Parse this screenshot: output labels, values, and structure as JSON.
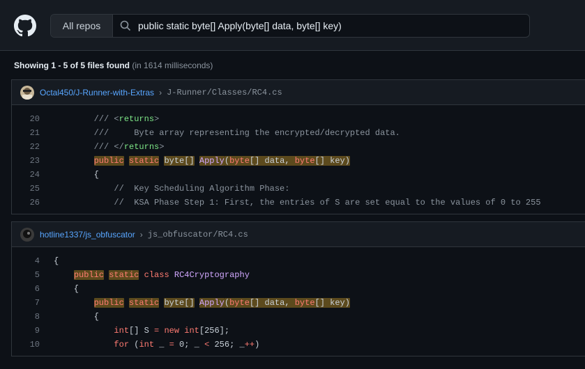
{
  "header": {
    "scope_label": "All repos",
    "query": "public static byte[] Apply(byte[] data, byte[] key)"
  },
  "summary": {
    "showing": "Showing 1 - 5 of 5 files found",
    "time": "(in 1614 milliseconds)"
  },
  "results": [
    {
      "repo": "Octal450/J-Runner-with-Extras",
      "path": "J-Runner/Classes/RC4.cs",
      "lines": [
        "20",
        "21",
        "22",
        "23",
        "24",
        "25",
        "26"
      ]
    },
    {
      "repo": "hotline1337/js_obfuscator",
      "path": "js_obfuscator/RC4.cs",
      "lines": [
        "4",
        "5",
        "6",
        "7",
        "8",
        "9",
        "10"
      ]
    }
  ],
  "icons": {
    "logo": "github-mark-icon",
    "search": "search-icon",
    "chevron": "chevron-right-icon"
  },
  "colors": {
    "keyword": "#ff7b72",
    "function": "#d2a8ff",
    "comment": "#8b949e",
    "match_highlight": "#5c4a1d",
    "link": "#58a6ff"
  }
}
